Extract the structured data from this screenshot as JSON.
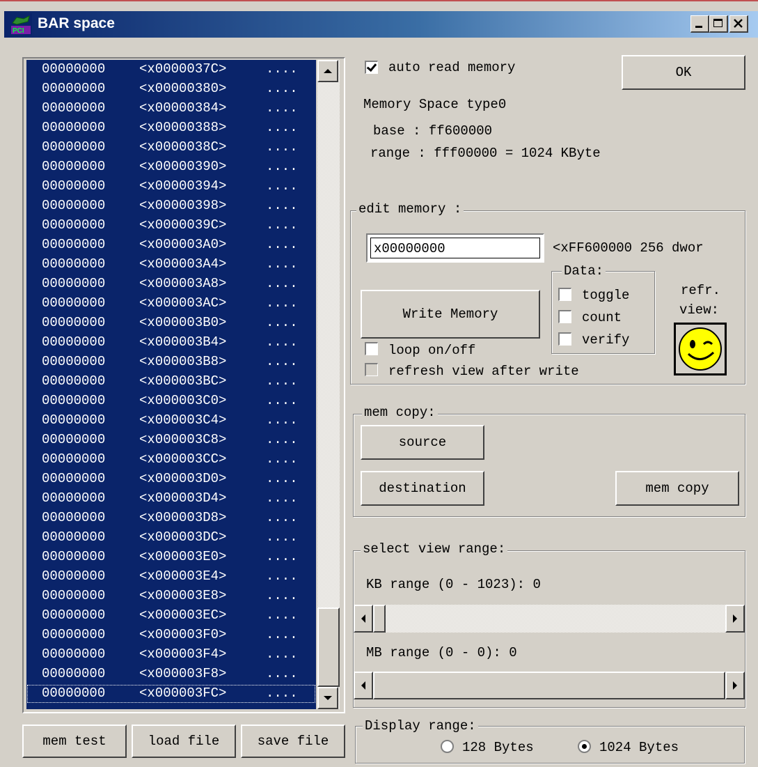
{
  "window": {
    "title": "BAR space"
  },
  "memory_list": {
    "rows": [
      {
        "value": "00000000",
        "addr": "<x0000037C>",
        "ascii": "...."
      },
      {
        "value": "00000000",
        "addr": "<x00000380>",
        "ascii": "...."
      },
      {
        "value": "00000000",
        "addr": "<x00000384>",
        "ascii": "...."
      },
      {
        "value": "00000000",
        "addr": "<x00000388>",
        "ascii": "...."
      },
      {
        "value": "00000000",
        "addr": "<x0000038C>",
        "ascii": "...."
      },
      {
        "value": "00000000",
        "addr": "<x00000390>",
        "ascii": "...."
      },
      {
        "value": "00000000",
        "addr": "<x00000394>",
        "ascii": "...."
      },
      {
        "value": "00000000",
        "addr": "<x00000398>",
        "ascii": "...."
      },
      {
        "value": "00000000",
        "addr": "<x0000039C>",
        "ascii": "...."
      },
      {
        "value": "00000000",
        "addr": "<x000003A0>",
        "ascii": "...."
      },
      {
        "value": "00000000",
        "addr": "<x000003A4>",
        "ascii": "...."
      },
      {
        "value": "00000000",
        "addr": "<x000003A8>",
        "ascii": "...."
      },
      {
        "value": "00000000",
        "addr": "<x000003AC>",
        "ascii": "...."
      },
      {
        "value": "00000000",
        "addr": "<x000003B0>",
        "ascii": "...."
      },
      {
        "value": "00000000",
        "addr": "<x000003B4>",
        "ascii": "...."
      },
      {
        "value": "00000000",
        "addr": "<x000003B8>",
        "ascii": "...."
      },
      {
        "value": "00000000",
        "addr": "<x000003BC>",
        "ascii": "...."
      },
      {
        "value": "00000000",
        "addr": "<x000003C0>",
        "ascii": "...."
      },
      {
        "value": "00000000",
        "addr": "<x000003C4>",
        "ascii": "...."
      },
      {
        "value": "00000000",
        "addr": "<x000003C8>",
        "ascii": "...."
      },
      {
        "value": "00000000",
        "addr": "<x000003CC>",
        "ascii": "...."
      },
      {
        "value": "00000000",
        "addr": "<x000003D0>",
        "ascii": "...."
      },
      {
        "value": "00000000",
        "addr": "<x000003D4>",
        "ascii": "...."
      },
      {
        "value": "00000000",
        "addr": "<x000003D8>",
        "ascii": "...."
      },
      {
        "value": "00000000",
        "addr": "<x000003DC>",
        "ascii": "...."
      },
      {
        "value": "00000000",
        "addr": "<x000003E0>",
        "ascii": "...."
      },
      {
        "value": "00000000",
        "addr": "<x000003E4>",
        "ascii": "...."
      },
      {
        "value": "00000000",
        "addr": "<x000003E8>",
        "ascii": "...."
      },
      {
        "value": "00000000",
        "addr": "<x000003EC>",
        "ascii": "...."
      },
      {
        "value": "00000000",
        "addr": "<x000003F0>",
        "ascii": "...."
      },
      {
        "value": "00000000",
        "addr": "<x000003F4>",
        "ascii": "...."
      },
      {
        "value": "00000000",
        "addr": "<x000003F8>",
        "ascii": "...."
      },
      {
        "value": "00000000",
        "addr": "<x000003FC>",
        "ascii": "...."
      }
    ]
  },
  "bottom_buttons": {
    "mem_test": "mem test",
    "load_file": "load file",
    "save_file": "save file"
  },
  "auto_read": {
    "label": "auto read memory",
    "checked": true
  },
  "ok_button": "OK",
  "info": {
    "space_type": "Memory Space type0",
    "base": "base : ff600000",
    "range": "range : fff00000 = 1024 KByte"
  },
  "edit_memory": {
    "title": "edit memory :",
    "address_value": "x00000000",
    "address_hint": "<xFF600000 256 dwor",
    "write_button": "Write Memory",
    "data_group": "Data:",
    "toggle": "toggle",
    "count": "count",
    "verify": "verify",
    "loop": "loop on/off",
    "refresh_after": "refresh view after write",
    "refr_label": "refr.",
    "view_label": "view:"
  },
  "mem_copy": {
    "title": "mem copy:",
    "source": "source",
    "destination": "destination",
    "copy": "mem copy"
  },
  "view_range": {
    "title": "select view range:",
    "kb_label": "KB range (0 - 1023): 0",
    "mb_label": "MB range (0 - 0): 0",
    "kb_value": 0,
    "mb_value": 0
  },
  "display_range": {
    "title": "Display range:",
    "opt128": "128 Bytes",
    "opt1024": "1024 Bytes",
    "selected": "1024 Bytes"
  },
  "colors": {
    "title_start": "#0a246a",
    "title_end": "#a6caf0",
    "list_bg": "#0a246a",
    "face": "#d4d0c8"
  }
}
